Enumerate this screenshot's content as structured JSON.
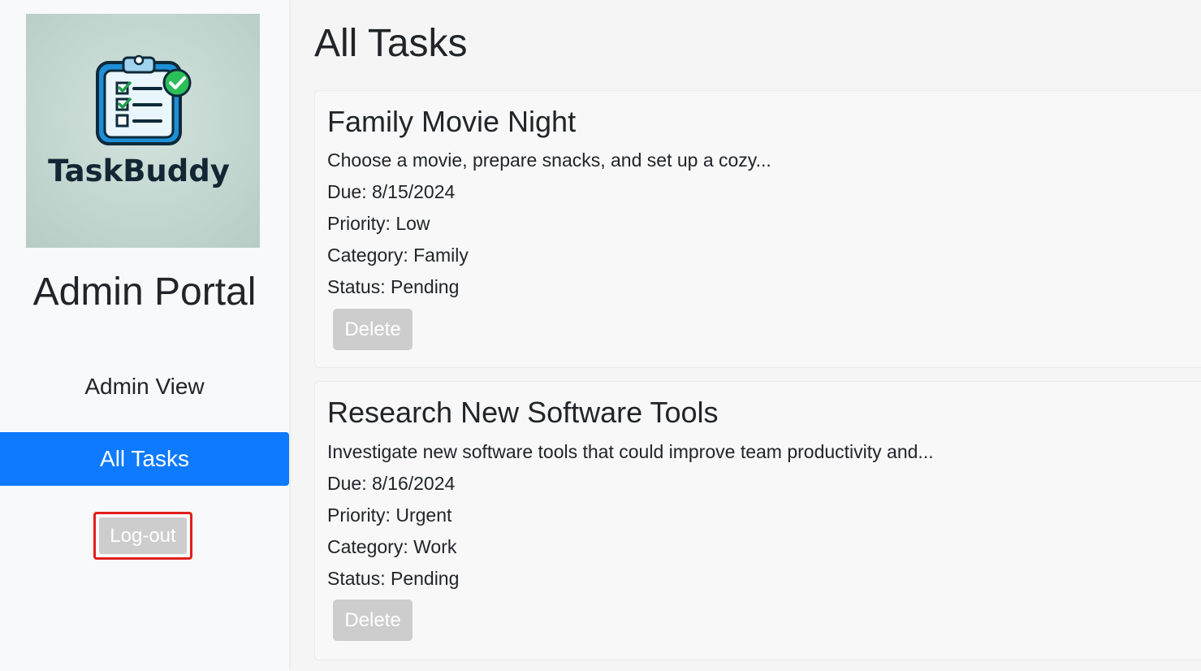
{
  "sidebar": {
    "logo_text": "TaskBuddy",
    "title": "Admin Portal",
    "nav": [
      {
        "label": "Admin View",
        "active": false
      },
      {
        "label": "All Tasks",
        "active": true
      }
    ],
    "logout_label": "Log-out"
  },
  "main": {
    "heading": "All Tasks",
    "tasks": [
      {
        "title": "Family Movie Night",
        "description": "Choose a movie, prepare snacks, and set up a cozy...",
        "due": "Due: 8/15/2024",
        "priority": "Priority: Low",
        "category": "Category: Family",
        "status": "Status: Pending",
        "delete_label": "Delete"
      },
      {
        "title": "Research New Software Tools",
        "description": "Investigate new software tools that could improve team productivity and...",
        "due": "Due: 8/16/2024",
        "priority": "Priority: Urgent",
        "category": "Category: Work",
        "status": "Status: Pending",
        "delete_label": "Delete"
      }
    ]
  },
  "colors": {
    "accent": "#0d7aff",
    "logout_border": "#e0201b",
    "button_disabled": "#cdcdcd"
  }
}
